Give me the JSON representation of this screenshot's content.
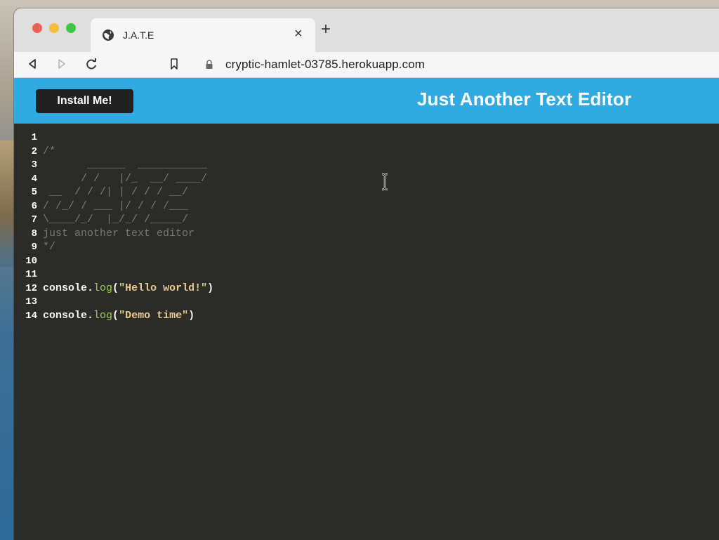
{
  "browser": {
    "tab_title": "J.A.T.E",
    "tab_close_label": "×",
    "new_tab_label": "+",
    "url": "cryptic-hamlet-03785.herokuapp.com"
  },
  "app": {
    "install_label": "Install Me!",
    "title": "Just Another Text Editor",
    "header_color": "#31a9e1"
  },
  "editor": {
    "lines": [
      {
        "number": "1",
        "text": ""
      },
      {
        "number": "2",
        "text": "/*"
      },
      {
        "number": "3",
        "text": "       ______  ___________"
      },
      {
        "number": "4",
        "text": "      / /   |/_  __/ ____/"
      },
      {
        "number": "5",
        "text": " __  / / /| | / / / __/"
      },
      {
        "number": "6",
        "text": "/ /_/ / ___ |/ / / /___"
      },
      {
        "number": "7",
        "text": "\\____/_/  |_/_/ /_____/"
      },
      {
        "number": "8",
        "text": "just another text editor"
      },
      {
        "number": "9",
        "text": "*/"
      },
      {
        "number": "10",
        "text": ""
      },
      {
        "number": "11",
        "text": ""
      },
      {
        "number": "12",
        "obj": "console",
        "dot": ".",
        "fn": "log",
        "open": "(",
        "str": "\"Hello world!\"",
        "close": ")"
      },
      {
        "number": "13",
        "text": ""
      },
      {
        "number": "14",
        "obj": "console",
        "dot": ".",
        "fn": "log",
        "open": "(",
        "str": "\"Demo time\"",
        "close": ")"
      }
    ]
  }
}
